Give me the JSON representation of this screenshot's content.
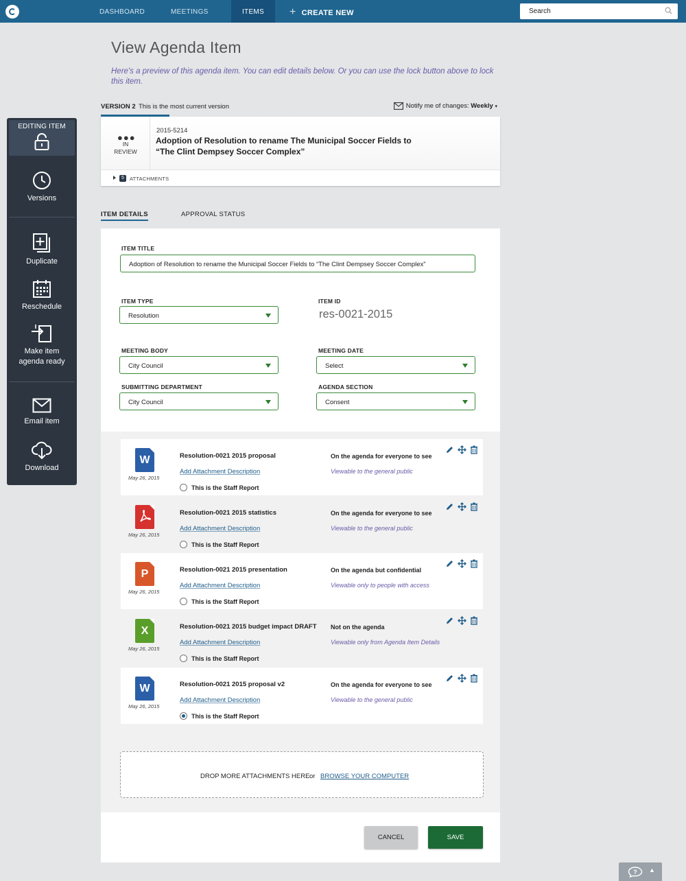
{
  "nav": {
    "dashboard": "DASHBOARD",
    "meetings": "MEETINGS",
    "items": "ITEMS",
    "create_new": "CREATE NEW",
    "search_placeholder": "Search"
  },
  "header": {
    "title": "View Agenda Item",
    "intro": "Here's a preview of this agenda item. You can edit details below. Or you can use the lock button above to lock this item."
  },
  "version": {
    "label": "VERSION 2",
    "description": "This is the most current version",
    "notify_label": "Notify me of changes:",
    "notify_value": "Weekly"
  },
  "item": {
    "status_line1": "IN",
    "status_line2": "REVIEW",
    "number": "2015-5214",
    "title_line1": "Adoption of Resolution to rename The Municipal Soccer Fields to",
    "title_line2": "“The Clint Dempsey Soccer Complex”",
    "attachment_count": "5",
    "attachments_label": "ATTACHMENTS"
  },
  "sidebar": {
    "editing": "EDITING ITEM",
    "versions": "Versions",
    "duplicate": "Duplicate",
    "reschedule": "Reschedule",
    "agenda_ready_1": "Make item",
    "agenda_ready_2": "agenda ready",
    "email": "Email item",
    "download": "Download"
  },
  "tabs": {
    "details": "ITEM DETAILS",
    "approval": "APPROVAL STATUS"
  },
  "form": {
    "item_title_label": "ITEM TITLE",
    "item_title_value": "Adoption of Resolution to rename the Municipal Soccer Fields to “The Clint Dempsey Soccer Complex”",
    "item_type_label": "ITEM TYPE",
    "item_type_value": "Resolution",
    "item_id_label": "ITEM ID",
    "item_id_value": "res-0021-2015",
    "meeting_body_label": "MEETING BODY",
    "meeting_body_value": "City Council",
    "meeting_date_label": "MEETING DATE",
    "meeting_date_value": "Select",
    "submitting_dept_label": "SUBMITTING DEPARTMENT",
    "submitting_dept_value": "City Council",
    "agenda_section_label": "AGENDA SECTION",
    "agenda_section_value": "Consent"
  },
  "attachments": [
    {
      "type": "word",
      "letter": "W",
      "date": "May 26, 2015",
      "name": "Resolution-0021 2015 proposal",
      "desc_link": "Add Attachment Description",
      "staff_report": "This is the Staff Report",
      "staff_selected": false,
      "visibility": "On the agenda for everyone to see",
      "visibility_sub": "Viewable to the general public"
    },
    {
      "type": "pdf",
      "letter": "",
      "date": "May 26, 2015",
      "name": "Resolution-0021 2015 statistics",
      "desc_link": "Add Attachment Description",
      "staff_report": "This is the Staff Report",
      "staff_selected": false,
      "visibility": "On the agenda for everyone to see",
      "visibility_sub": "Viewable to the general public"
    },
    {
      "type": "powerpoint",
      "letter": "P",
      "date": "May 26, 2015",
      "name": "Resolution-0021 2015 presentation",
      "desc_link": "Add Attachment Description",
      "staff_report": "This is the Staff Report",
      "staff_selected": false,
      "visibility": "On the agenda but confidential",
      "visibility_sub": "Viewable only to people with access"
    },
    {
      "type": "excel",
      "letter": "X",
      "date": "May 26, 2015",
      "name": "Resolution-0021 2015 budget impact DRAFT",
      "desc_link": "Add Attachment Description",
      "staff_report": "This is the Staff Report",
      "staff_selected": false,
      "visibility": "Not on the agenda",
      "visibility_sub": "Viewable only from Agenda Item Details"
    },
    {
      "type": "word",
      "letter": "W",
      "date": "May 26, 2015",
      "name": "Resolution-0021 2015 proposal v2",
      "desc_link": "Add Attachment Description",
      "staff_report": "This is the Staff Report",
      "staff_selected": true,
      "visibility": "On the agenda for everyone to see",
      "visibility_sub": "Viewable to the general public"
    }
  ],
  "dropzone": {
    "text": "DROP MORE ATTACHMENTS HERE",
    "or": "or",
    "browse": "BROWSE YOUR COMPUTER"
  },
  "buttons": {
    "cancel": "CANCEL",
    "save": "SAVE"
  },
  "colors": {
    "nav_bg": "#1f6590",
    "sidebar_bg": "#2c3540",
    "field_border": "#3b8a3b",
    "save_bg": "#1c6a35",
    "link": "#1f5d8a",
    "intro_text": "#6a5aa8"
  }
}
